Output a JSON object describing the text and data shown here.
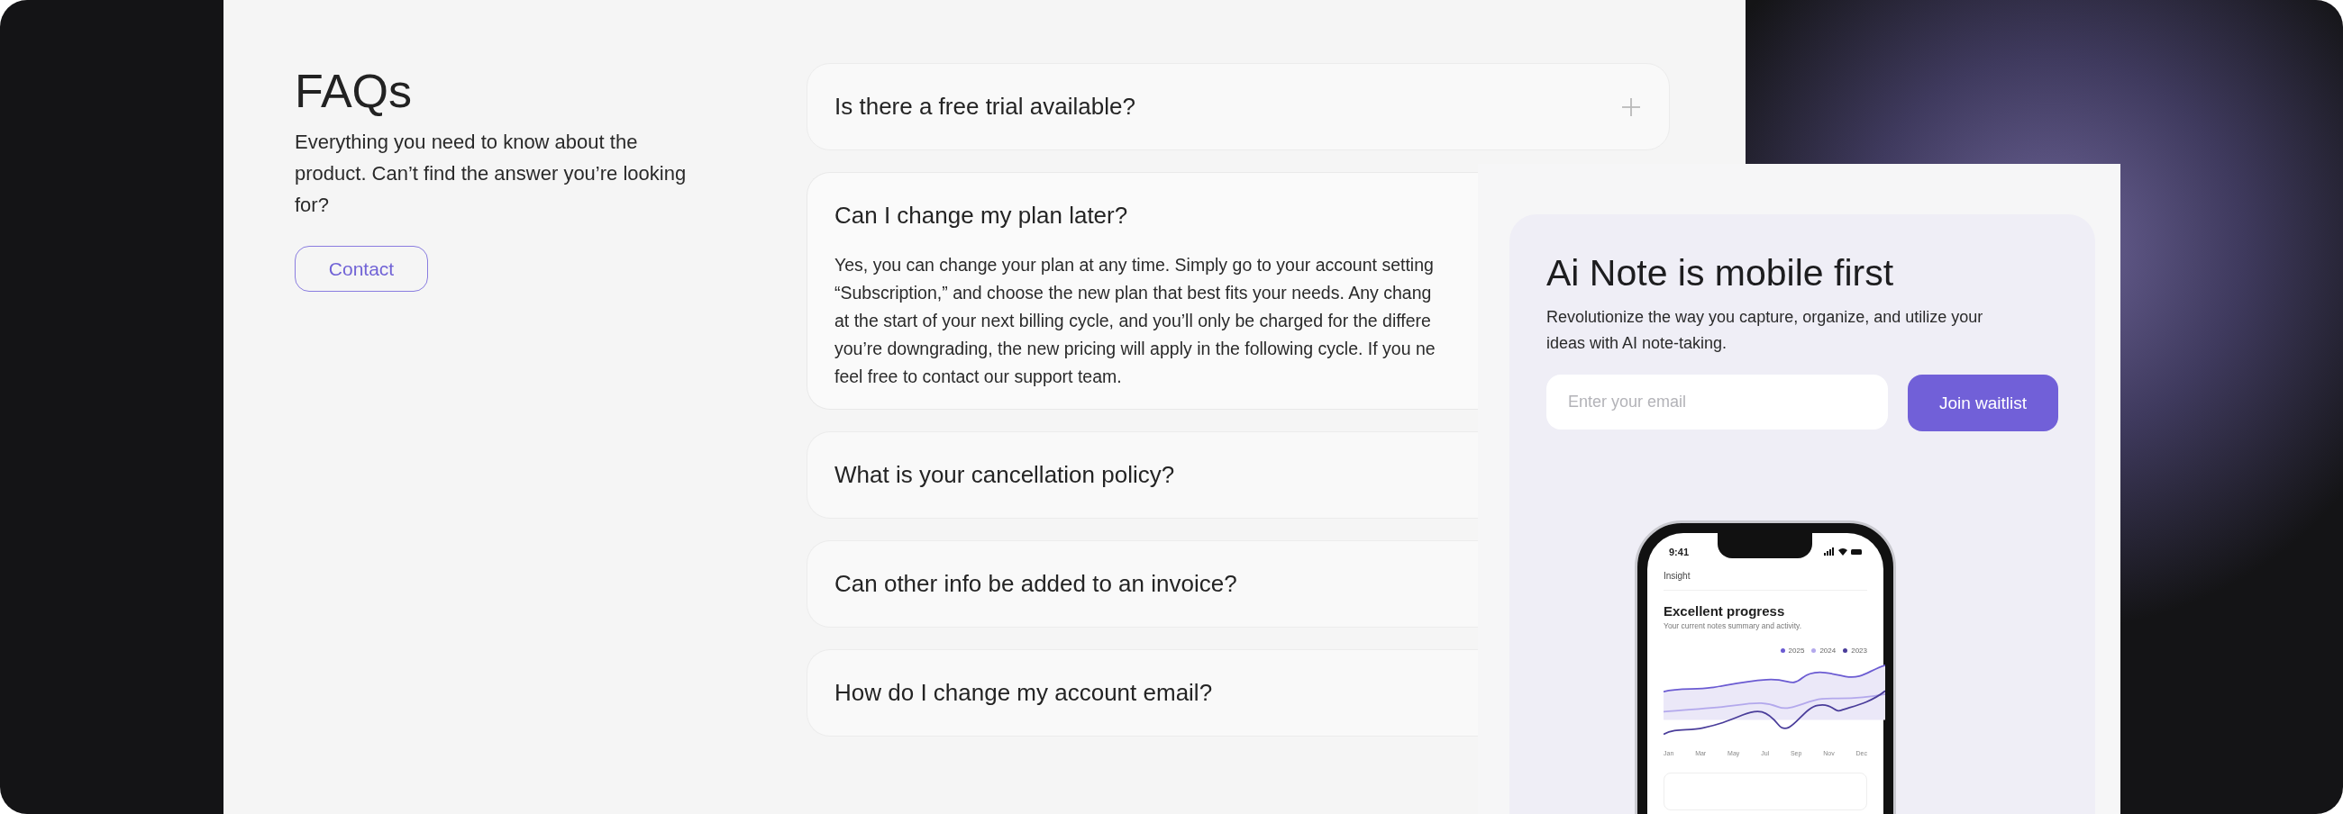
{
  "faq": {
    "title": "FAQs",
    "subtitle": "Everything you need to know about the product. Can’t find the answer you’re looking for?",
    "contact_button": "Contact",
    "items": [
      {
        "question": "Is there a free trial available?",
        "expanded": false,
        "toggle_visible": true
      },
      {
        "question": "Can I change my plan later?",
        "expanded": true,
        "toggle_visible": false,
        "answer_lines": [
          "Yes, you can change your plan at any time. Simply go to your account setting",
          "“Subscription,” and choose the new plan that best fits your needs. Any chang",
          "at the start of your next billing cycle, and you’ll only be charged for the differe",
          "you’re downgrading, the new pricing will apply in the following cycle. If you ne",
          "feel free to contact our support team."
        ]
      },
      {
        "question": "What is your cancellation policy?",
        "expanded": false,
        "toggle_visible": false
      },
      {
        "question": "Can other info be added to an invoice?",
        "expanded": false,
        "toggle_visible": false
      },
      {
        "question": "How do I change my account email?",
        "expanded": false,
        "toggle_visible": false
      }
    ]
  },
  "promo": {
    "title": "Ai Note is mobile first",
    "description": "Revolutionize the way you capture, organize, and utilize your ideas with AI note-taking.",
    "email_field": {
      "placeholder": "Enter your email"
    },
    "button": "Join waitlist",
    "phone": {
      "time": "9:41",
      "header": "Insight",
      "card_title": "Excellent progress",
      "card_subtitle": "Your current notes summary and activity.",
      "legend": [
        {
          "label": "2025",
          "color": "#6b5bd2"
        },
        {
          "label": "2024",
          "color": "#b3a8ec"
        },
        {
          "label": "2023",
          "color": "#4a3d9a"
        }
      ],
      "months": [
        "Jan",
        "Mar",
        "May",
        "Jul",
        "Sep",
        "Nov",
        "Dec"
      ]
    }
  }
}
